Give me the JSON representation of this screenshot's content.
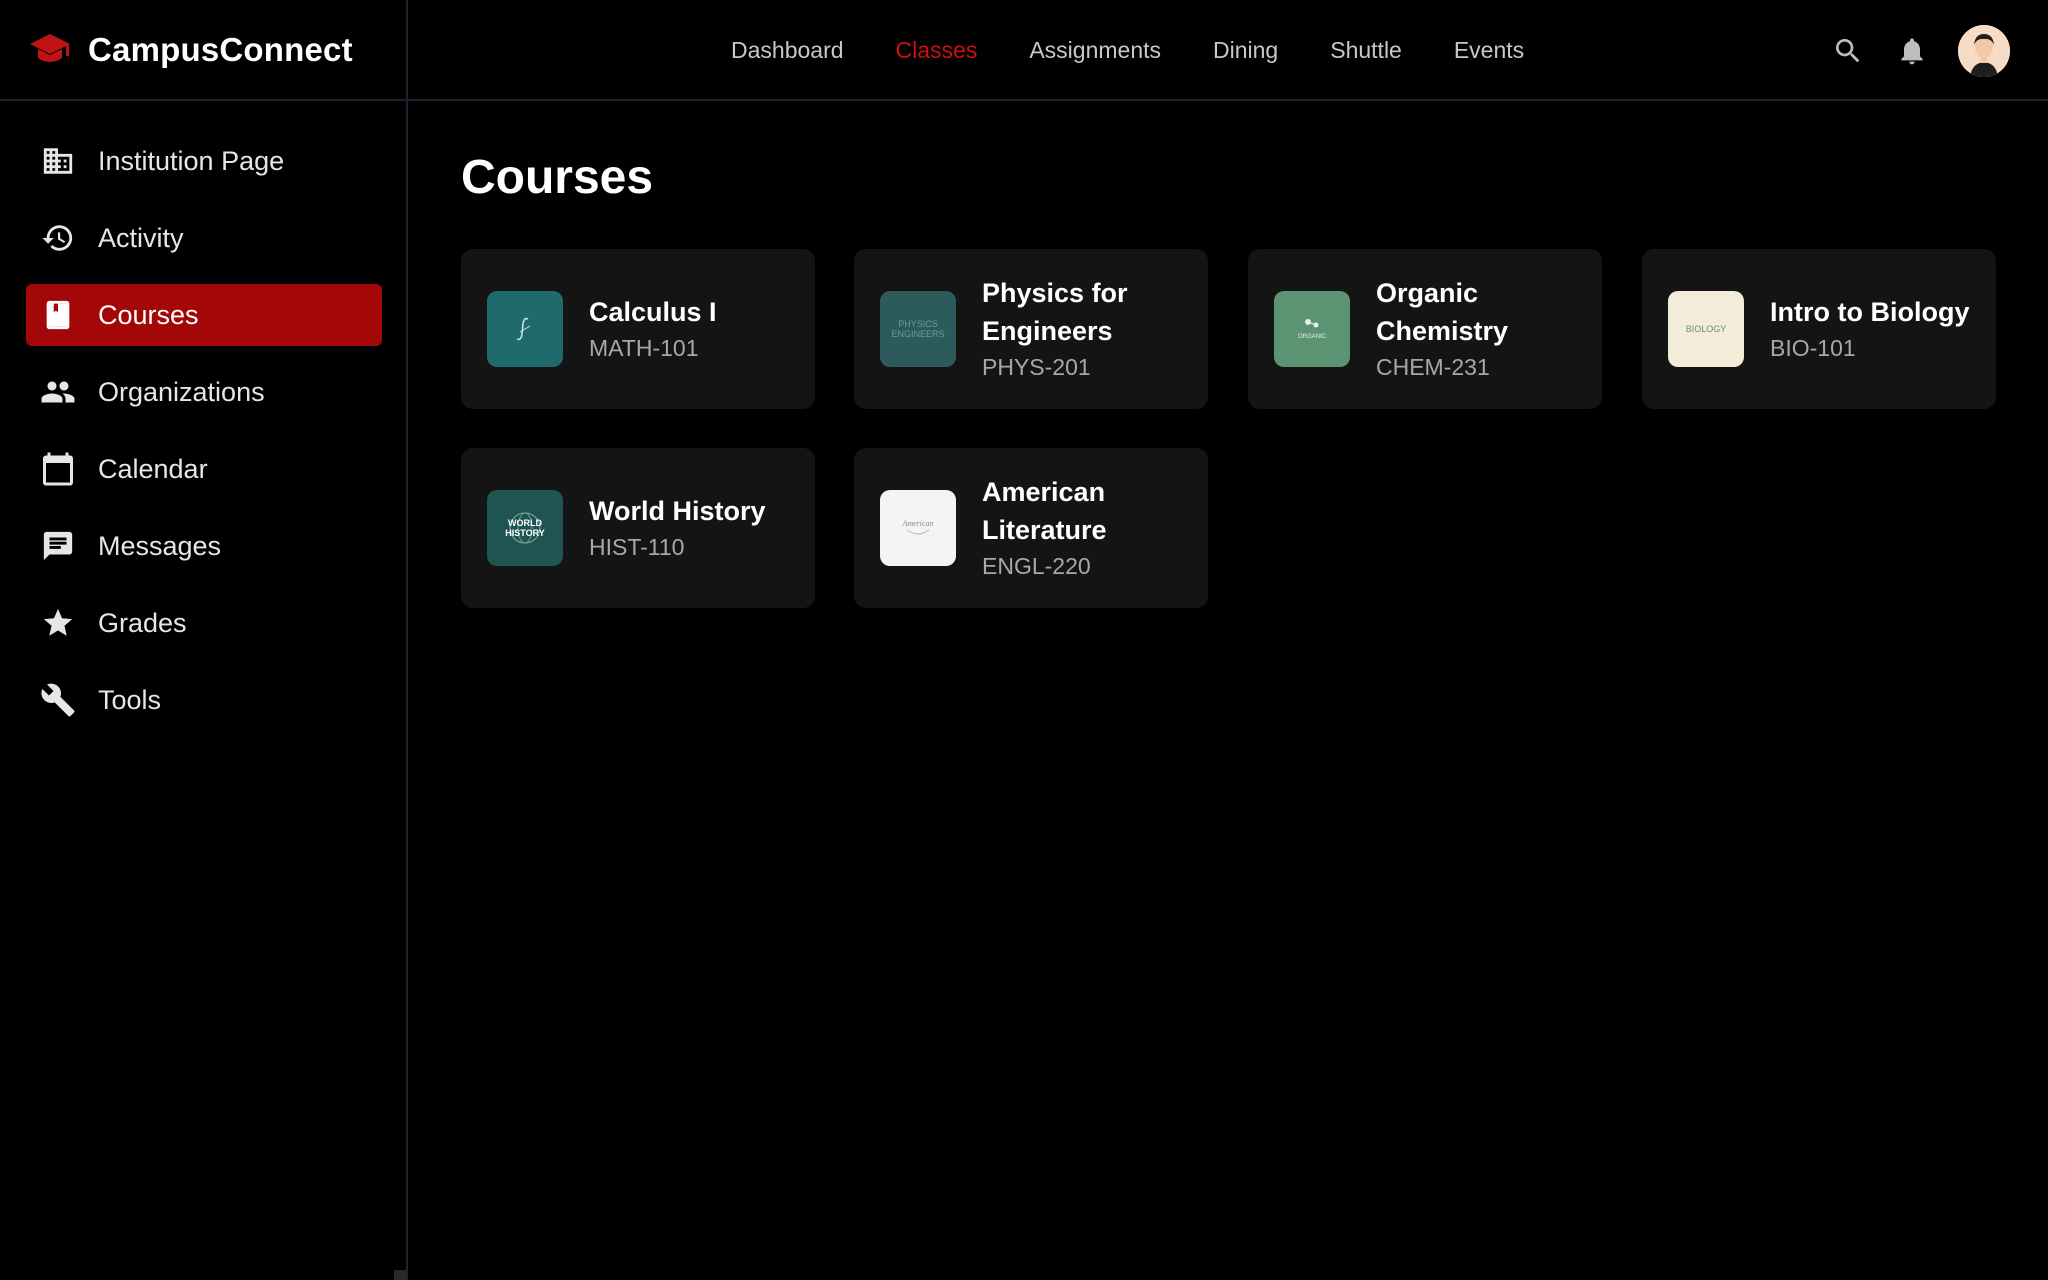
{
  "app": {
    "name": "CampusConnect"
  },
  "sidebar": {
    "items": [
      {
        "label": "Institution Page",
        "icon": "building-icon",
        "active": false
      },
      {
        "label": "Activity",
        "icon": "history-icon",
        "active": false
      },
      {
        "label": "Courses",
        "icon": "book-icon",
        "active": true
      },
      {
        "label": "Organizations",
        "icon": "people-icon",
        "active": false
      },
      {
        "label": "Calendar",
        "icon": "calendar-icon",
        "active": false
      },
      {
        "label": "Messages",
        "icon": "message-icon",
        "active": false
      },
      {
        "label": "Grades",
        "icon": "star-icon",
        "active": false
      },
      {
        "label": "Tools",
        "icon": "wrench-icon",
        "active": false
      }
    ]
  },
  "topnav": {
    "items": [
      {
        "label": "Dashboard",
        "active": false
      },
      {
        "label": "Classes",
        "active": true
      },
      {
        "label": "Assignments",
        "active": false
      },
      {
        "label": "Dining",
        "active": false
      },
      {
        "label": "Shuttle",
        "active": false
      },
      {
        "label": "Events",
        "active": false
      }
    ]
  },
  "page": {
    "title": "Courses"
  },
  "courses": [
    {
      "title": "Calculus I",
      "code": "MATH-101",
      "thumb_color": "#1f6a6d",
      "thumb_text": ""
    },
    {
      "title": "Physics for Engineers",
      "code": "PHYS-201",
      "thumb_color": "#2d5a5a",
      "thumb_text": "PHYSICS ENGINEERS"
    },
    {
      "title": "Organic Chemistry",
      "code": "CHEM-231",
      "thumb_color": "#5c9473",
      "thumb_text": "ORGANIC"
    },
    {
      "title": "Intro to Biology",
      "code": "BIO-101",
      "thumb_color": "#f3ecd9",
      "thumb_text": "BIOLOGY"
    },
    {
      "title": "World History",
      "code": "HIST-110",
      "thumb_color": "#1e5553",
      "thumb_text": "WORLD HISTORY"
    },
    {
      "title": "American Literature",
      "code": "ENGL-220",
      "thumb_color": "#f4f4f4",
      "thumb_text": "American"
    }
  ],
  "colors": {
    "accent": "#a30707",
    "active_link": "#cc1010",
    "card_bg": "#141414"
  }
}
